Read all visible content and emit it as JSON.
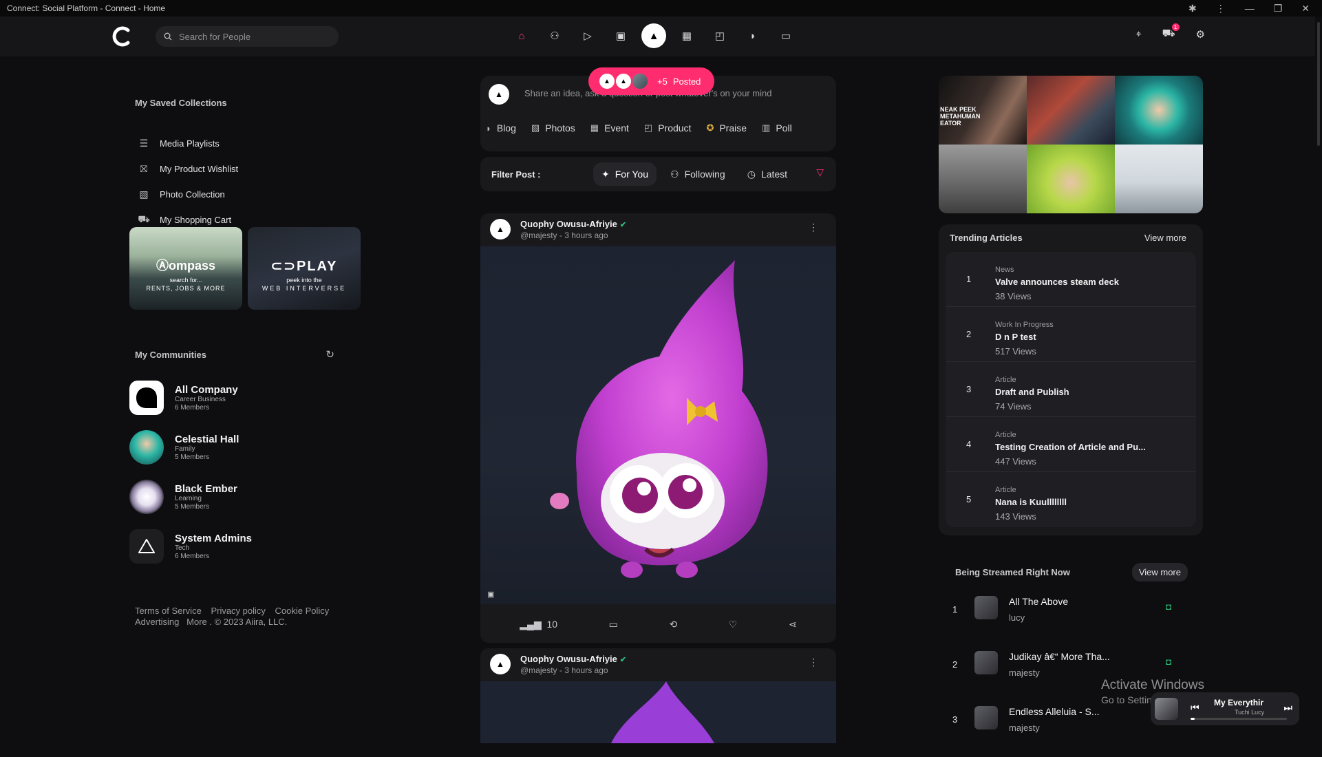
{
  "window": {
    "title": "Connect: Social Platform - Connect - Home"
  },
  "header": {
    "search_placeholder": "Search for People",
    "nav_icons": [
      "home-icon",
      "users-icon",
      "play-icon",
      "image-icon",
      "profile-icon",
      "calendar-icon",
      "bag-icon",
      "rss-icon",
      "message-icon"
    ],
    "cart_badge": "1"
  },
  "sidebar": {
    "saved_title": "My Saved Collections",
    "collections": [
      {
        "label": "Media Playlists",
        "icon": "playlist-icon"
      },
      {
        "label": "My Product Wishlist",
        "icon": "gift-icon"
      },
      {
        "label": "Photo Collection",
        "icon": "image-icon"
      },
      {
        "label": "My Shopping Cart",
        "icon": "cart-icon"
      }
    ],
    "promos": [
      {
        "title": "ompass",
        "line1": "search for...",
        "line2": "RENTS, JOBS & MORE"
      },
      {
        "title": "PLAY",
        "line1": "peek into the",
        "line2": "WEB INTERVERSE"
      }
    ],
    "communities_title": "My Communities",
    "communities": [
      {
        "name": "All Company",
        "category": "Career Business",
        "members": "6 Members"
      },
      {
        "name": "Celestial Hall",
        "category": "Family",
        "members": "5 Members"
      },
      {
        "name": "Black Ember",
        "category": "Learning",
        "members": "5 Members"
      },
      {
        "name": "System Admins",
        "category": "Tech",
        "members": "6 Members"
      }
    ],
    "footer": {
      "links": [
        "Terms of Service",
        "Privacy policy",
        "Cookie Policy"
      ],
      "line2": "Advertising   More . © 2023 Aiira, LLC."
    }
  },
  "composer": {
    "prompt": "Share an idea, ask a question or post whatever's on your mind",
    "types": [
      {
        "label": "Blog",
        "icon": "rss-icon"
      },
      {
        "label": "Photos",
        "icon": "image-icon"
      },
      {
        "label": "Event",
        "icon": "calendar-icon"
      },
      {
        "label": "Product",
        "icon": "bag-icon"
      },
      {
        "label": "Praise",
        "icon": "award-icon"
      },
      {
        "label": "Poll",
        "icon": "poll-icon"
      }
    ],
    "posted_count": "+5",
    "posted_label": "Posted"
  },
  "filter": {
    "label": "Filter Post :",
    "chips": [
      {
        "label": "For You",
        "active": true
      },
      {
        "label": "Following",
        "active": false
      },
      {
        "label": "Latest",
        "active": false
      }
    ]
  },
  "posts": [
    {
      "author": "Quophy Owusu-Afriyie",
      "meta": "@majesty - 3 hours ago",
      "views": "10"
    },
    {
      "author": "Quophy Owusu-Afriyie",
      "meta": "@majesty - 3 hours ago"
    }
  ],
  "trending": {
    "title": "Trending Articles",
    "view_more": "View more",
    "items": [
      {
        "rank": "1",
        "category": "News",
        "title": "Valve announces steam deck",
        "views": "38 Views"
      },
      {
        "rank": "2",
        "category": "Work In Progress",
        "title": "D n P test",
        "views": "517 Views"
      },
      {
        "rank": "3",
        "category": "Article",
        "title": "Draft and Publish",
        "views": "74 Views"
      },
      {
        "rank": "4",
        "category": "Article",
        "title": "Testing Creation of Article and Pu...",
        "views": "447 Views"
      },
      {
        "rank": "5",
        "category": "Article",
        "title": "Nana is Kuullllllll",
        "views": "143 Views"
      }
    ]
  },
  "streams": {
    "title": "Being Streamed Right Now",
    "view_more": "View more",
    "items": [
      {
        "rank": "1",
        "title": "All The Above",
        "user": "lucy"
      },
      {
        "rank": "2",
        "title": "Judikay â€“ More Tha...",
        "user": "majesty"
      },
      {
        "rank": "3",
        "title": "Endless Alleluia - S...",
        "user": "majesty"
      }
    ]
  },
  "watermark": {
    "line1": "Activate Windows",
    "line2": "Go to Settings to activate Windows."
  },
  "player": {
    "title": "My Everythir",
    "artist": "Tuchi Lucy"
  }
}
